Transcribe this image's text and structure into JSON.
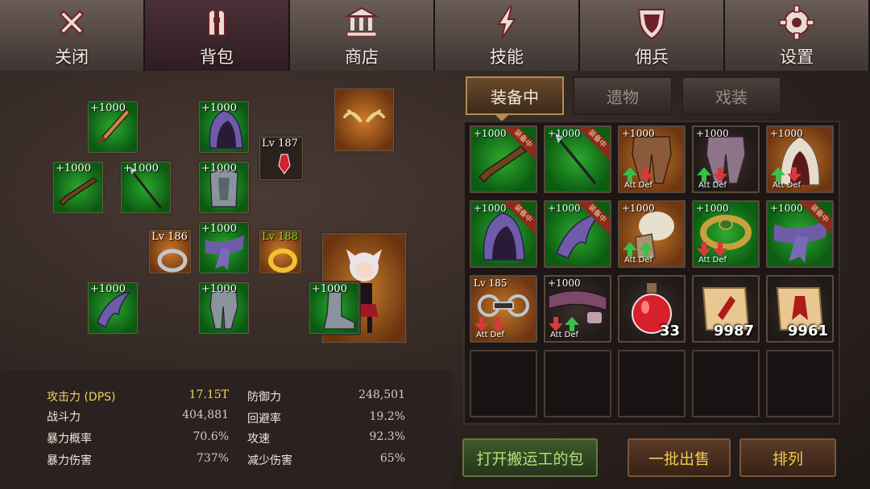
{
  "nav": {
    "tabs": [
      {
        "label": "关闭",
        "icon": "close-icon"
      },
      {
        "label": "背包",
        "icon": "backpack-icon",
        "active": true
      },
      {
        "label": "商店",
        "icon": "shop-icon"
      },
      {
        "label": "技能",
        "icon": "lightning-icon"
      },
      {
        "label": "佣兵",
        "icon": "shield-icon"
      },
      {
        "label": "设置",
        "icon": "gear-icon"
      }
    ]
  },
  "equipped": {
    "slots": [
      {
        "label": "+1000",
        "item": "sword-icon"
      },
      {
        "label": "+1000",
        "item": "hood-icon"
      },
      {
        "label": "Lv 187",
        "item": "red-gem-icon"
      },
      {
        "label": "",
        "item": "antlers-icon"
      },
      {
        "label": "+1000",
        "item": "rifle-icon"
      },
      {
        "label": "+1000",
        "item": "spear-icon"
      },
      {
        "label": "+1000",
        "item": "chest-armor-icon"
      },
      {
        "label": "Lv 186",
        "item": "silver-ring-icon"
      },
      {
        "label": "+1000",
        "item": "sash-icon"
      },
      {
        "label": "Lv 188",
        "item": "gold-ring-icon"
      },
      {
        "label": "+1000",
        "item": "claw-glove-icon"
      },
      {
        "label": "+1000",
        "item": "leg-armor-icon"
      },
      {
        "label": "+1000",
        "item": "boots-icon"
      }
    ],
    "character": "fox-girl-character"
  },
  "stats": {
    "left": [
      {
        "label": "攻击力 (DPS)",
        "value": "17.15T",
        "highlight": true
      },
      {
        "label": "战斗力",
        "value": "404,881"
      },
      {
        "label": "暴力概率",
        "value": "70.6%"
      },
      {
        "label": "暴力伤害",
        "value": "737%"
      }
    ],
    "right": [
      {
        "label": "防御力",
        "value": "248,501"
      },
      {
        "label": "回避率",
        "value": "19.2%"
      },
      {
        "label": "攻速",
        "value": "92.3%"
      },
      {
        "label": "减少伤害",
        "value": "65%"
      }
    ]
  },
  "subtabs": [
    {
      "label": "装备中",
      "active": true
    },
    {
      "label": "遗物"
    },
    {
      "label": "戏装"
    }
  ],
  "bag": {
    "ribbon_label": "装备中",
    "compare_label": "Att  Def",
    "cells": [
      {
        "label": "+1000",
        "item": "rifle-icon",
        "bg": "green",
        "ribbon": true
      },
      {
        "label": "+1000",
        "item": "spear-icon",
        "bg": "green",
        "ribbon": true
      },
      {
        "label": "+1000",
        "item": "leather-pants-icon",
        "bg": "brown",
        "compare": [
          "up",
          "down"
        ]
      },
      {
        "label": "+1000",
        "item": "purple-pants-icon",
        "bg": "dark",
        "compare": [
          "up",
          "down"
        ]
      },
      {
        "label": "+1000",
        "item": "white-hood-icon",
        "bg": "brown",
        "compare": [
          "up",
          "down"
        ]
      },
      {
        "label": "+1000",
        "item": "hood-icon",
        "bg": "green",
        "ribbon": true
      },
      {
        "label": "+1000",
        "item": "claw-glove-icon",
        "bg": "green",
        "ribbon": true
      },
      {
        "label": "+1000",
        "item": "fur-gauntlet-icon",
        "bg": "brown",
        "compare": [
          "up",
          "up"
        ]
      },
      {
        "label": "+1000",
        "item": "gold-ring-icon",
        "bg": "green",
        "compare": [
          "down",
          "down"
        ]
      },
      {
        "label": "+1000",
        "item": "sash-icon",
        "bg": "green",
        "ribbon": true
      },
      {
        "label": "Lv 185",
        "item": "chain-icon",
        "bg": "brown",
        "compare": [
          "down",
          "down"
        ]
      },
      {
        "label": "+1000",
        "item": "belt-icon",
        "bg": "dark",
        "compare": [
          "down",
          "up"
        ]
      },
      {
        "label": "",
        "item": "red-potion-icon",
        "bg": "dark",
        "count": "33"
      },
      {
        "label": "",
        "item": "scroll-icon",
        "bg": "dark",
        "count": "9987"
      },
      {
        "label": "",
        "item": "scroll-rune-icon",
        "bg": "dark",
        "count": "9961"
      },
      {
        "empty": true
      },
      {
        "empty": true
      },
      {
        "empty": true
      },
      {
        "empty": true
      },
      {
        "empty": true
      }
    ]
  },
  "buttons": {
    "open_porter_bag": "打开搬运工的包",
    "bulk_sell": "一批出售",
    "sort": "排列"
  },
  "colors": {
    "gold": "#f2d25a",
    "equip_green": "#2eab2f",
    "equip_orange": "#c27628",
    "up_arrow": "#36c24a",
    "down_arrow": "#d63a3a"
  }
}
